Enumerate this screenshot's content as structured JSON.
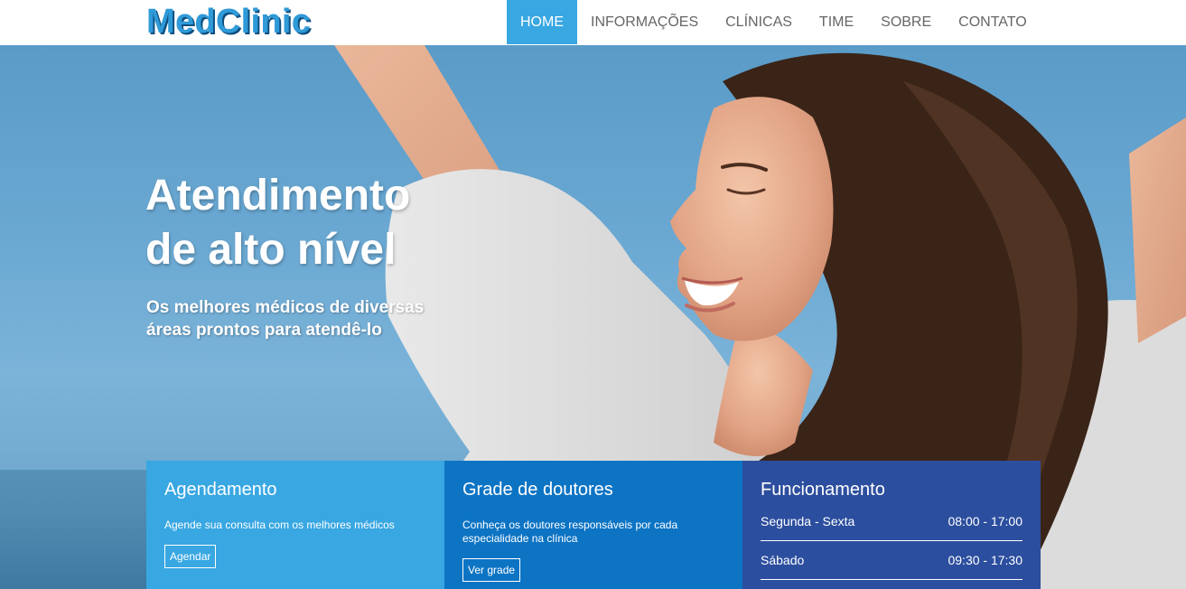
{
  "brand": {
    "logo_text": "MedClinic"
  },
  "nav": {
    "items": [
      {
        "label": "HOME",
        "active": true
      },
      {
        "label": "INFORMAÇÕES",
        "active": false
      },
      {
        "label": "CLÍNICAS",
        "active": false
      },
      {
        "label": "TIME",
        "active": false
      },
      {
        "label": "SOBRE",
        "active": false
      },
      {
        "label": "CONTATO",
        "active": false
      }
    ]
  },
  "hero": {
    "title_line1": "Atendimento",
    "title_line2": "de alto nível",
    "subtitle_line1": "Os melhores médicos de diversas",
    "subtitle_line2": "áreas prontos para atendê-lo"
  },
  "boxes": {
    "scheduling": {
      "title": "Agendamento",
      "text": "Agende sua consulta com os melhores médicos",
      "button": "Agendar"
    },
    "doctors": {
      "title": "Grade de doutores",
      "text": "Conheça os doutores responsáveis por cada especialidade na clínica",
      "button": "Ver grade"
    },
    "hours": {
      "title": "Funcionamento",
      "rows": [
        {
          "day": "Segunda - Sexta",
          "time": "08:00 - 17:00"
        },
        {
          "day": "Sábado",
          "time": "09:30 - 17:30"
        }
      ]
    }
  },
  "colors": {
    "brand": "#2f9ad8",
    "nav_active": "#38a7e2",
    "box_1": "#38a7e2",
    "box_2": "#0d74c4",
    "box_3": "#2c4e9e"
  }
}
